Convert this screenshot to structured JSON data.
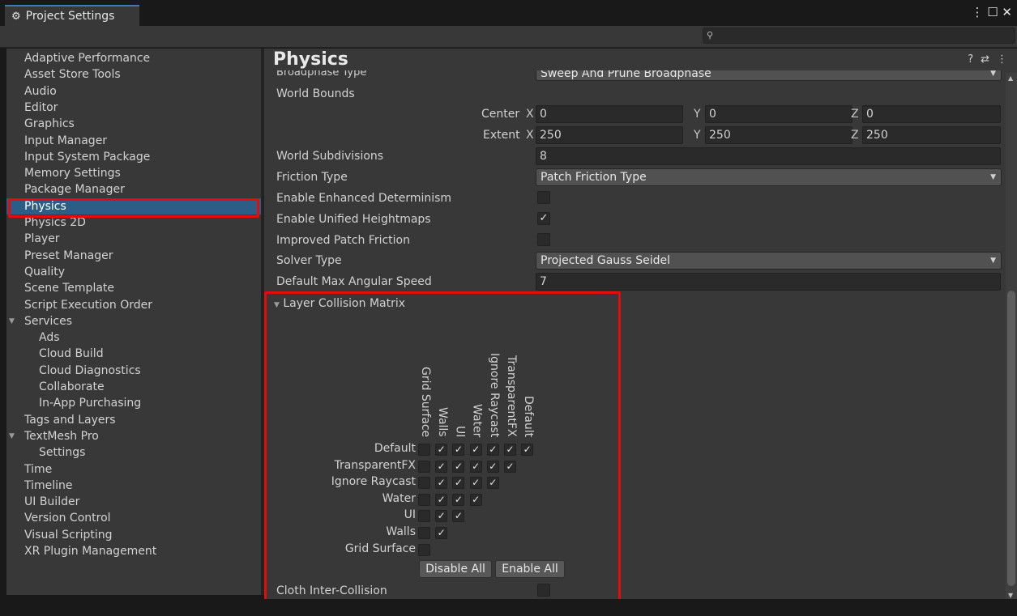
{
  "window": {
    "tab_title": "Project Settings",
    "controls": "⋮ ☐ ✕",
    "search": {
      "icon": "search-icon",
      "placeholder": "",
      "value": ""
    }
  },
  "sidebar": {
    "items": [
      {
        "label": "Adaptive Performance"
      },
      {
        "label": "Asset Store Tools"
      },
      {
        "label": "Audio"
      },
      {
        "label": "Editor"
      },
      {
        "label": "Graphics"
      },
      {
        "label": "Input Manager"
      },
      {
        "label": "Input System Package"
      },
      {
        "label": "Memory Settings"
      },
      {
        "label": "Package Manager"
      },
      {
        "label": "Physics",
        "selected": true
      },
      {
        "label": "Physics 2D"
      },
      {
        "label": "Player"
      },
      {
        "label": "Preset Manager"
      },
      {
        "label": "Quality"
      },
      {
        "label": "Scene Template"
      },
      {
        "label": "Script Execution Order"
      },
      {
        "label": "Services",
        "expanded": true
      },
      {
        "label": "Ads"
      },
      {
        "label": "Cloud Build"
      },
      {
        "label": "Cloud Diagnostics"
      },
      {
        "label": "Collaborate"
      },
      {
        "label": "In-App Purchasing"
      },
      {
        "label": "Tags and Layers"
      },
      {
        "label": "TextMesh Pro",
        "expanded": true
      },
      {
        "label": "Settings"
      },
      {
        "label": "Time"
      },
      {
        "label": "Timeline"
      },
      {
        "label": "UI Builder"
      },
      {
        "label": "Version Control"
      },
      {
        "label": "Visual Scripting"
      },
      {
        "label": "XR Plugin Management"
      }
    ]
  },
  "physics": {
    "title": "Physics",
    "header_icons": [
      "help-icon",
      "preset-icon",
      "more-icon"
    ],
    "broadphase": {
      "label": "Broadphase Type",
      "value": "Sweep And Prune Broadphase"
    },
    "world_bounds": {
      "label": "World Bounds",
      "center": {
        "label": "Center",
        "x": "0",
        "y": "0",
        "z": "0"
      },
      "extent": {
        "label": "Extent",
        "x": "250",
        "y": "250",
        "z": "250"
      },
      "axis": {
        "x": "X",
        "y": "Y",
        "z": "Z"
      }
    },
    "world_subdivisions": {
      "label": "World Subdivisions",
      "value": "8"
    },
    "friction_type": {
      "label": "Friction Type",
      "value": "Patch Friction Type"
    },
    "enhanced_determinism": {
      "label": "Enable Enhanced Determinism",
      "checked": false
    },
    "unified_heightmaps": {
      "label": "Enable Unified Heightmaps",
      "checked": true
    },
    "improved_patch_friction": {
      "label": "Improved Patch Friction",
      "checked": false
    },
    "solver_type": {
      "label": "Solver Type",
      "value": "Projected Gauss Seidel"
    },
    "max_angular_speed": {
      "label": "Default Max Angular Speed",
      "value": "7"
    },
    "layer_matrix": {
      "title": "Layer Collision Matrix",
      "column_labels": [
        "Grid Surface",
        "Walls",
        "UI",
        "Water",
        "Ignore Raycast",
        "TransparentFX",
        "Default"
      ],
      "rows": [
        {
          "label": "Default",
          "cells": [
            false,
            true,
            true,
            true,
            true,
            true,
            true
          ]
        },
        {
          "label": "TransparentFX",
          "cells": [
            false,
            true,
            true,
            true,
            true,
            true
          ]
        },
        {
          "label": "Ignore Raycast",
          "cells": [
            false,
            true,
            true,
            true,
            true
          ]
        },
        {
          "label": "Water",
          "cells": [
            false,
            true,
            true,
            true
          ]
        },
        {
          "label": "UI",
          "cells": [
            false,
            true,
            true
          ]
        },
        {
          "label": "Walls",
          "cells": [
            false,
            true
          ]
        },
        {
          "label": "Grid Surface",
          "cells": [
            false
          ]
        }
      ],
      "disable_all": "Disable All",
      "enable_all": "Enable All"
    },
    "cloth_inter_collision": {
      "label": "Cloth Inter-Collision",
      "checked": false
    }
  },
  "colors": {
    "panel": "#383838",
    "field": "#2a2a2a",
    "selection": "#2c5d87",
    "highlight": "#e30b0b",
    "tab_accent": "#3a79bb"
  }
}
